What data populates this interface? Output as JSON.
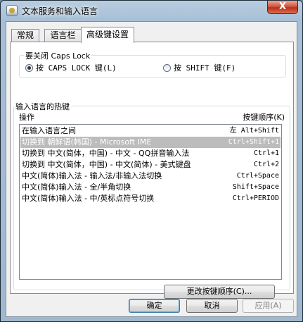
{
  "window": {
    "title": "文本服务和输入语言",
    "close_label": "X"
  },
  "tabs": [
    {
      "label": "常规"
    },
    {
      "label": "语言栏"
    },
    {
      "label": "高级键设置"
    }
  ],
  "caps_lock": {
    "group_label": "要关闭 Caps Lock",
    "option1": "按 CAPS LOCK 键(L)",
    "option2": "按 SHIFT 键(F)",
    "selected": "option1"
  },
  "hotkeys": {
    "group_label": "输入语言的热键",
    "col_action": "操作",
    "col_sequence": "按键顺序(K)",
    "rows": [
      {
        "action": "在输入语言之间",
        "keys": "左 Alt+Shift",
        "selected": false
      },
      {
        "action": "切换到 朝鲜语(韩国) - Microsoft IME",
        "keys": "Ctrl+Shift+1",
        "selected": true
      },
      {
        "action": "切换到 中文(简体，中国) - 中文 - QQ拼音输入法",
        "keys": "Ctrl+1",
        "selected": false
      },
      {
        "action": "切换到 中文(简体，中国) - 中文(简体) - 美式键盘",
        "keys": "Ctrl+2",
        "selected": false
      },
      {
        "action": "中文(简体)输入法 - 输入法/非输入法切换",
        "keys": "Ctrl+Space",
        "selected": false
      },
      {
        "action": "中文(简体)输入法 - 全/半角切换",
        "keys": "Shift+Space",
        "selected": false
      },
      {
        "action": "中文(简体)输入法 - 中/英标点符号切换",
        "keys": "Ctrl+PERIOD",
        "selected": false
      }
    ],
    "change_button": "更改按键顺序(C)..."
  },
  "buttons": {
    "ok": "确定",
    "cancel": "取消",
    "apply": "应用(A)"
  }
}
